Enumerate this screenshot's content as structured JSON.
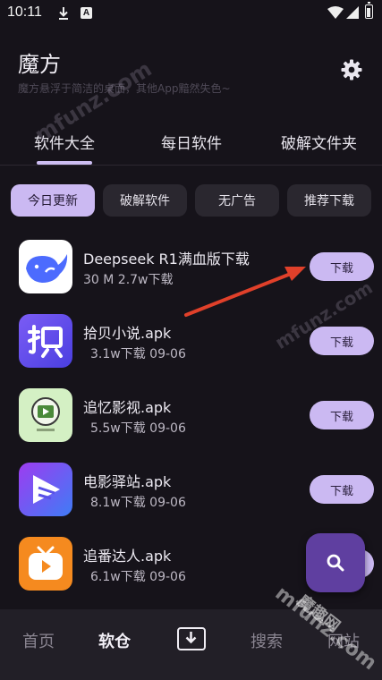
{
  "status_bar": {
    "time": "10:11",
    "a_badge": "A"
  },
  "header": {
    "title": "魔方",
    "subtitle": "魔方悬浮于简洁的桌面，其他App黯然失色~",
    "settings_icon": "gear-icon"
  },
  "tabs": [
    {
      "label": "软件大全",
      "active": true
    },
    {
      "label": "每日软件",
      "active": false
    },
    {
      "label": "破解文件夹",
      "active": false
    }
  ],
  "chips": [
    {
      "label": "今日更新",
      "active": true
    },
    {
      "label": "破解软件",
      "active": false
    },
    {
      "label": "无广告",
      "active": false
    },
    {
      "label": "推荐下载",
      "active": false
    }
  ],
  "apps": [
    {
      "name": "Deepseek R1满血版下载",
      "meta": "30 M  2.7w下载",
      "button": "下载",
      "icon": "deepseek-whale-icon"
    },
    {
      "name": "拾贝小说.apk",
      "meta": "3.1w下载  09-06",
      "button": "下载",
      "icon": "shibei-novel-icon"
    },
    {
      "name": "追忆影视.apk",
      "meta": "5.5w下载  09-06",
      "button": "下载",
      "icon": "zhuiyi-video-icon"
    },
    {
      "name": "电影驿站.apk",
      "meta": "8.1w下载  09-06",
      "button": "下载",
      "icon": "movie-station-icon"
    },
    {
      "name": "追番达人.apk",
      "meta": "6.1w下载  09-06",
      "button": "下载",
      "icon": "anime-tv-icon"
    }
  ],
  "fab": {
    "icon": "search-icon"
  },
  "bottom_nav": [
    {
      "label": "首页",
      "active": false
    },
    {
      "label": "软仓",
      "active": true
    },
    {
      "label": "",
      "icon": "download-box-icon",
      "active": false
    },
    {
      "label": "搜索",
      "active": false
    },
    {
      "label": "网站",
      "active": false
    }
  ],
  "watermarks": {
    "domain": "mfunz.com",
    "brand": "魔趣网"
  },
  "colors": {
    "accent": "#cbb9f2",
    "background": "#16131a",
    "fab": "#5f3fa0",
    "annotation_arrow": "#e0402a"
  }
}
